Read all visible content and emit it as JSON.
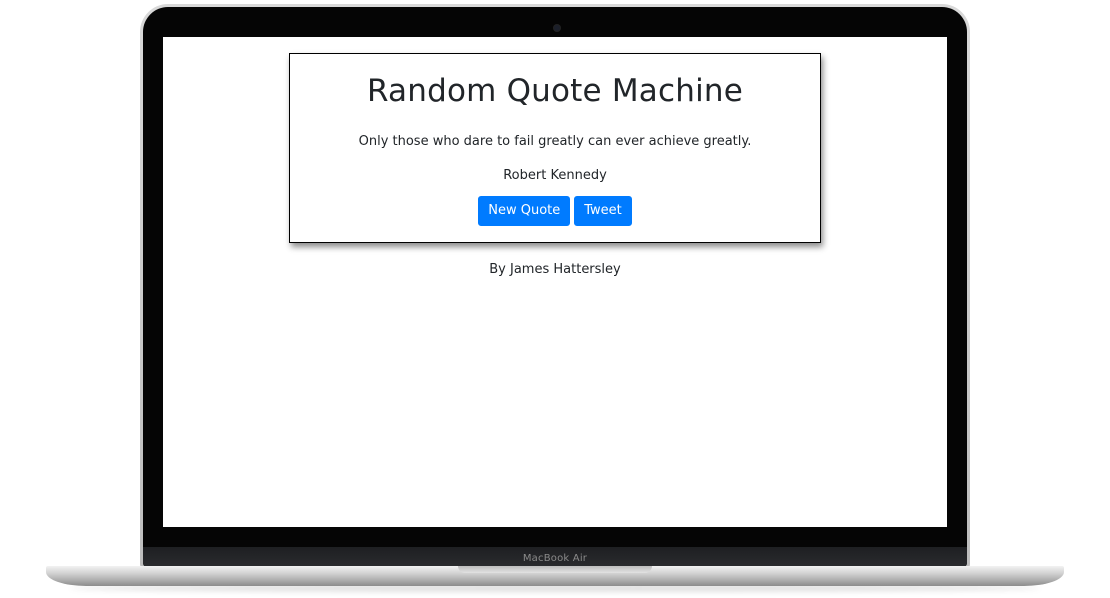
{
  "app": {
    "title": "Random Quote Machine"
  },
  "quote": {
    "text": "Only those who dare to fail greatly can ever achieve greatly.",
    "author": "Robert Kennedy"
  },
  "buttons": {
    "new_quote": "New Quote",
    "tweet": "Tweet"
  },
  "footer": {
    "credit": "By James Hattersley"
  },
  "device": {
    "label": "MacBook Air"
  },
  "colors": {
    "button_bg": "#007bff",
    "text": "#212529",
    "bezel": "#050505"
  }
}
